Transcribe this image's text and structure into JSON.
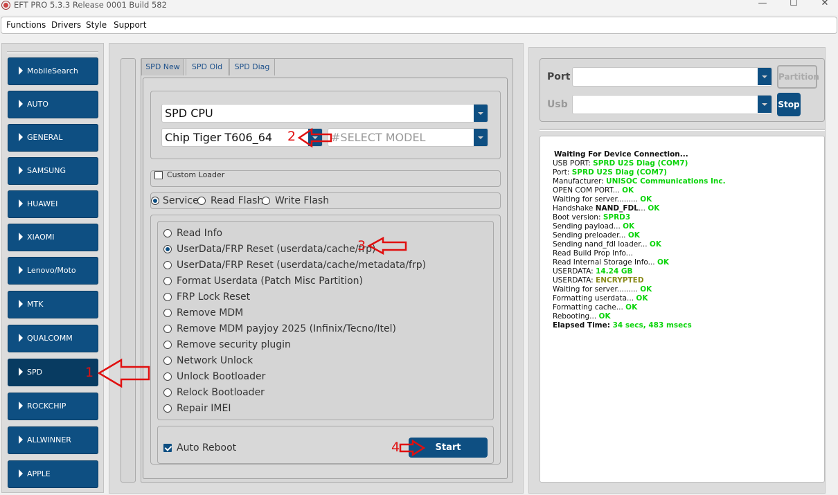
{
  "window": {
    "title": "EFT PRO 5.3.3 Release 0001 Build 582",
    "minimize": "—",
    "maximize": "☐",
    "close": "✕"
  },
  "menu": [
    "Functions",
    "Drivers",
    "Style",
    "Support"
  ],
  "sidebar": [
    {
      "label": "MobileSearch"
    },
    {
      "label": "AUTO"
    },
    {
      "label": "GENERAL"
    },
    {
      "label": "SAMSUNG"
    },
    {
      "label": "HUAWEI"
    },
    {
      "label": "XIAOMI"
    },
    {
      "label": "Lenovo/Moto"
    },
    {
      "label": "MTK"
    },
    {
      "label": "QUALCOMM"
    },
    {
      "label": "SPD"
    },
    {
      "label": "ROCKCHIP"
    },
    {
      "label": "ALLWINNER"
    },
    {
      "label": "APPLE"
    }
  ],
  "tabs": [
    "SPD New",
    "SPD Old",
    "SPD Diag"
  ],
  "cpu_select": "SPD CPU",
  "chip_select": "Chip Tiger T606_64",
  "model_placeholder": "#SELECT MODEL",
  "custom_loader": "Custom Loader",
  "modes": [
    {
      "label": "Service",
      "selected": true
    },
    {
      "label": "Read  Flash",
      "selected": false
    },
    {
      "label": "Write Flash",
      "selected": false
    }
  ],
  "operations": [
    {
      "label": "Read Info",
      "selected": false
    },
    {
      "label": "UserData/FRP Reset (userdata/cache/frp)",
      "selected": true
    },
    {
      "label": "UserData/FRP Reset (userdata/cache/metadata/frp)",
      "selected": false
    },
    {
      "label": "Format Userdata (Patch Misc Partition)",
      "selected": false
    },
    {
      "label": "FRP Lock Reset",
      "selected": false
    },
    {
      "label": "Remove MDM",
      "selected": false
    },
    {
      "label": "Remove MDM payjoy 2025 (Infinix/Tecno/Itel)",
      "selected": false
    },
    {
      "label": "Remove security plugin",
      "selected": false
    },
    {
      "label": "Network Unlock",
      "selected": false
    },
    {
      "label": "Unlock Bootloader",
      "selected": false
    },
    {
      "label": "Relock Bootloader",
      "selected": false
    },
    {
      "label": "Repair IMEI",
      "selected": false
    }
  ],
  "auto_reboot": "Auto Reboot",
  "start": "Start",
  "port_label": "Port",
  "usb_label": "Usb",
  "partition_btn": "Partition",
  "stop_btn": "Stop",
  "annotations": [
    "1",
    "2",
    "3",
    "4"
  ],
  "log": [
    {
      "text": "Waiting For Device Connection...",
      "value": "",
      "style": "bold"
    },
    {
      "text": "USB PORT: ",
      "value": "SPRD U2S Diag (COM7)"
    },
    {
      "text": "Port: ",
      "value": "SPRD U2S Diag (COM7)"
    },
    {
      "text": "Manufacturer: ",
      "value": "UNISOC Communications Inc."
    },
    {
      "text": "OPEN COM PORT... ",
      "value": "OK"
    },
    {
      "text": "Waiting for server......... ",
      "value": "OK"
    },
    {
      "text": "Handshake ",
      "bold": "NAND_FDL",
      "text2": "... ",
      "value": "OK"
    },
    {
      "text": "Boot version: ",
      "value": "SPRD3"
    },
    {
      "text": "Sending payload... ",
      "value": "OK"
    },
    {
      "text": "Sending preloader... ",
      "value": "OK"
    },
    {
      "text": "Sending nand_fdl loader... ",
      "value": "OK"
    },
    {
      "text": "Read Build Prop Info...",
      "value": ""
    },
    {
      "text": "Read Internal Storage Info... ",
      "value": "OK"
    },
    {
      "text": "USERDATA: ",
      "value": "14.24 GB"
    },
    {
      "text": "USERDATA: ",
      "value": "ENCRYPTED",
      "olive": true
    },
    {
      "text": "Waiting for server......... ",
      "value": "OK"
    },
    {
      "text": "Formatting userdata... ",
      "value": "OK"
    },
    {
      "text": "Formatting cache... ",
      "value": "OK"
    },
    {
      "text": "Rebooting... ",
      "value": "OK"
    },
    {
      "text": "Elapsed Time: ",
      "value": "34 secs, 483 msecs",
      "style": "bold"
    }
  ]
}
